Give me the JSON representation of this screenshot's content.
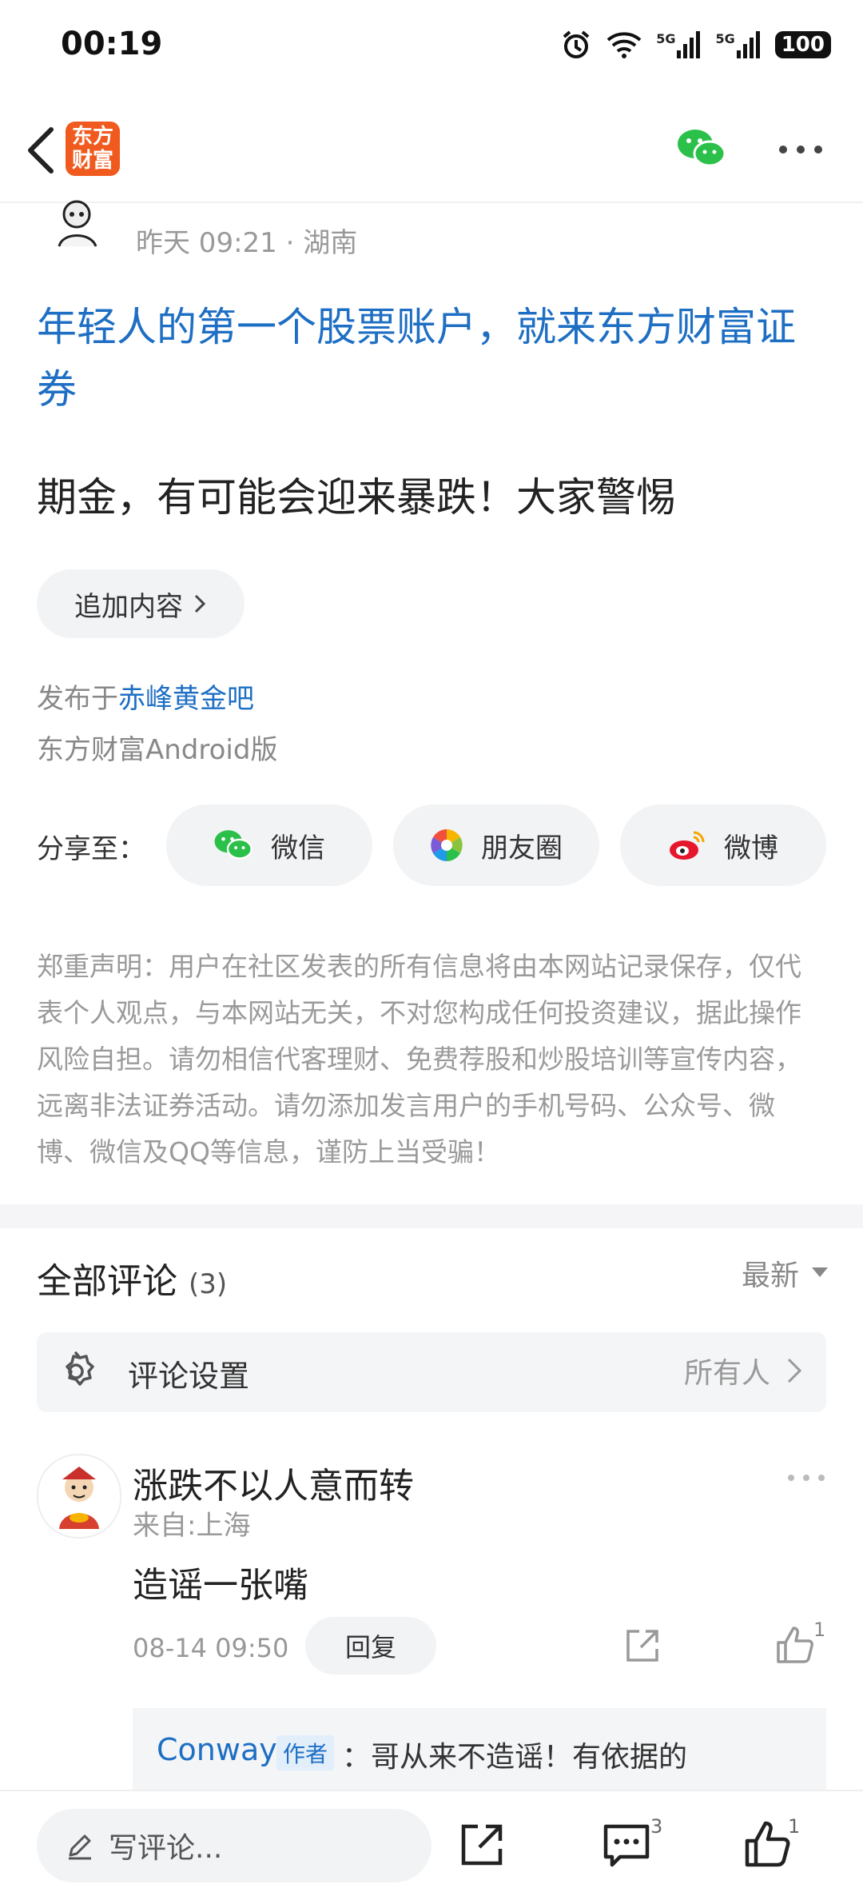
{
  "status_bar": {
    "time": "00:19",
    "battery": "100",
    "signal_label_1": "5G",
    "signal_label_2": "5G"
  },
  "header": {
    "app_logo_line1": "东方",
    "app_logo_line2": "财富"
  },
  "post": {
    "meta": "昨天 09:21 · 湖南",
    "link_title": "年轻人的第一个股票账户，就来东方财富证券",
    "body": "期金，有可能会迎来暴跌！大家警惕",
    "add_content_label": "追加内容",
    "published_prefix": "发布于",
    "forum_name": "赤峰黄金吧",
    "client": "东方财富Android版"
  },
  "share": {
    "label": "分享至：",
    "targets": [
      {
        "label": "微信"
      },
      {
        "label": "朋友圈"
      },
      {
        "label": "微博"
      }
    ]
  },
  "disclaimer": "郑重声明：用户在社区发表的所有信息将由本网站记录保存，仅代表个人观点，与本网站无关，不对您构成任何投资建议，据此操作风险自担。请勿相信代客理财、免费荐股和炒股培训等宣传内容，远离非法证券活动。请勿添加发言用户的手机号码、公众号、微博、微信及QQ等信息，谨防上当受骗！",
  "comments": {
    "title": "全部评论",
    "count": "(3)",
    "sort": "最新",
    "settings_label": "评论设置",
    "settings_value": "所有人",
    "items": [
      {
        "user": "涨跌不以人意而转",
        "location": "来自:上海",
        "text": "造谣一张嘴",
        "time": "08-14 09:50",
        "reply_label": "回复",
        "like_count": "1",
        "reply": {
          "name": "Conway",
          "badge": "作者",
          "text": "：哥从来不造谣！有依据的"
        }
      }
    ]
  },
  "bottom_bar": {
    "input_placeholder": "写评论...",
    "comment_count": "3",
    "like_count": "1"
  },
  "colors": {
    "link": "#1e6fc4",
    "brand": "#f05a1e",
    "wechat": "#2bc04a",
    "weibo": "#e6162d"
  }
}
